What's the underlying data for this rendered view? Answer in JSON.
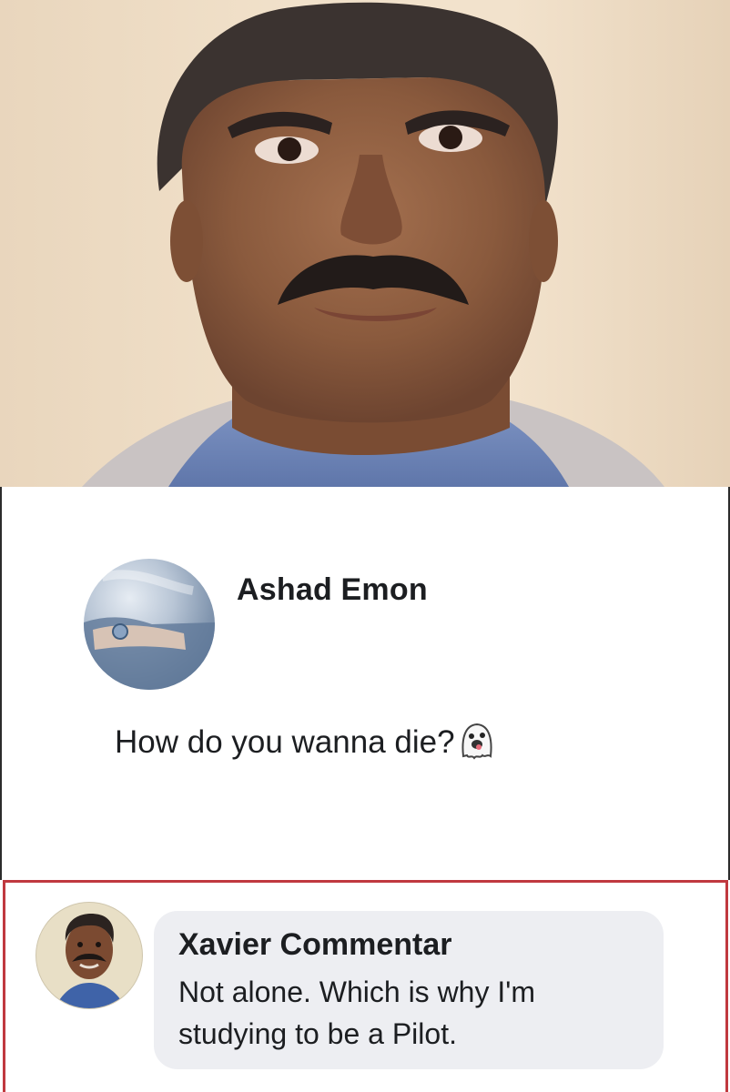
{
  "post": {
    "author": "Ashad Emon",
    "text": "How do you wanna die?",
    "emoji": "ghost-emoji"
  },
  "comment": {
    "author": "Xavier Commentar",
    "text": "Not alone. Which is why I'm studying to be a Pilot."
  },
  "colors": {
    "highlight_border": "#c0393f",
    "bubble_bg": "#edeef2",
    "text": "#1c1e21"
  }
}
